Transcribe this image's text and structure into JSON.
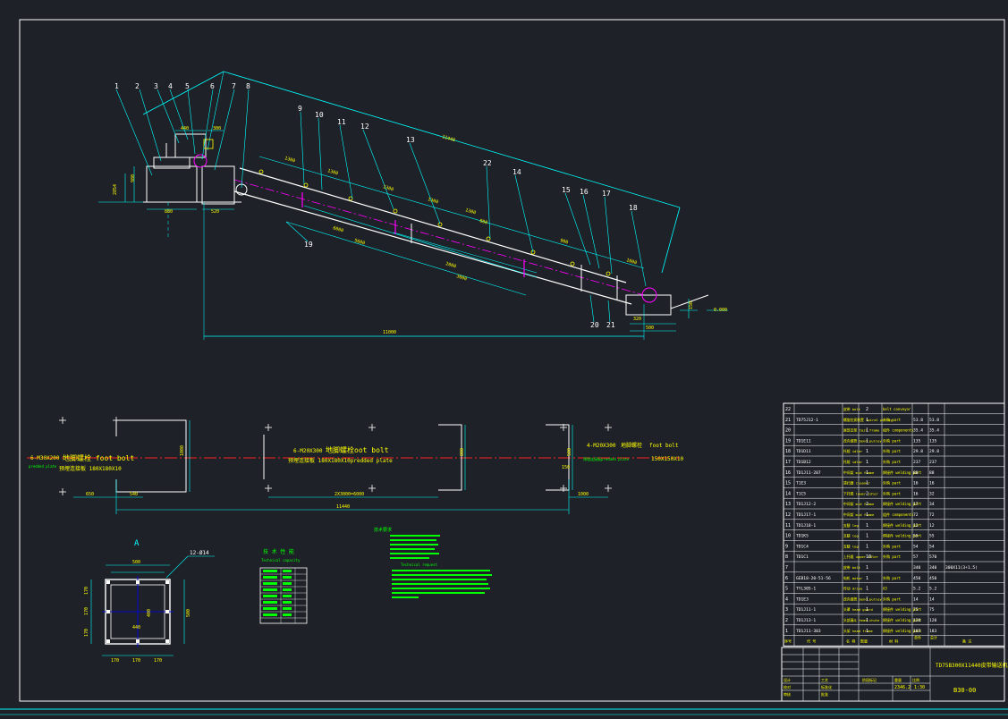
{
  "colors": {
    "background": "#1e2228",
    "line_white": "#ffffff",
    "line_cyan": "#00ffff",
    "line_green": "#00ff00",
    "line_yellow": "#ffff00",
    "line_red": "#ff2020",
    "line_magenta": "#ff00ff"
  },
  "main_view": {
    "part_numbers": [
      "1",
      "2",
      "3",
      "4",
      "5",
      "6",
      "7",
      "8",
      "9",
      "10",
      "11",
      "12",
      "13",
      "22",
      "14",
      "15",
      "16",
      "17",
      "18",
      "19",
      "20",
      "21"
    ],
    "dims": {
      "overall_length": "11000",
      "incline_length": "11440",
      "height_left": "980",
      "elev_left": "2854",
      "elev_right": "0.000",
      "d_440": "440",
      "d_300": "300",
      "d_880": "880",
      "d_520": "520",
      "d_1300a": "1300",
      "d_1300b": "1300",
      "d_1300c": "1300",
      "d_1300d": "1300",
      "d_1300e": "1300",
      "d_900": "900",
      "d_5600": "5600",
      "d_6000": "6000",
      "d_3000": "3000",
      "d_2000": "2000",
      "d_800": "800",
      "d_1000": "1000",
      "d_320": "320",
      "d_500": "500",
      "d_150": "150"
    }
  },
  "foundation_view": {
    "left_bolt": "6-M30X200",
    "left_label": "地脚螺栓 foot bolt",
    "left_plate_en": "predded plate",
    "left_plate_cn": "预埋连接板 180X180X10",
    "mid_bolt": "6-M20X300",
    "mid_label": "地脚螺栓oot bolt",
    "mid_plate": "预埋连接板 180X180X10predded plate",
    "right_bolt": "4-M20X300",
    "right_label": "地脚螺栓",
    "right_label_en": "foot bolt",
    "right_plate_cn": "预埋连接板",
    "right_plate_en": "predded plate",
    "right_plate_size": "150X150X10",
    "d_1000a": "1000",
    "d_650": "650",
    "d_540": "540",
    "d_2x3000": "2X3000=6000",
    "d_11440": "11440",
    "d_800": "800",
    "d_500": "500",
    "d_150": "150",
    "d_1000b": "1000"
  },
  "section_a": {
    "label": "A",
    "bolt_note": "12-Ø14",
    "d_500": "500",
    "d_440": "440",
    "d_400": "400",
    "d_500v": "500",
    "d_170a": "170",
    "d_170b": "170",
    "d_170c": "170",
    "d_170v1": "170",
    "d_170v2": "170",
    "d_170v3": "170"
  },
  "tech_capacity": {
    "title_cn": "技 术 性 能",
    "title_en": "Technical capacity"
  },
  "tech_requirements": {
    "title_cn": "技术要求",
    "title_en": "Technical request"
  },
  "parts_table": {
    "header": {
      "no": "序号",
      "code": "代 号",
      "name": "名 称",
      "qty": "数量",
      "material": "材 料",
      "unit_wt": "单件",
      "total_wt": "总计",
      "note": "备 注"
    },
    "rows": [
      {
        "no": "22",
        "code": "",
        "name": "皮带 belt",
        "qty": "2",
        "material": "belt conveyor",
        "w1": "",
        "w2": "",
        "note": ""
      },
      {
        "no": "21",
        "code": "TD75J12-1",
        "name": "螺旋拉紧装置 spiral pulley",
        "qty": "1",
        "material": "外购 part",
        "w1": "53.8",
        "w2": "53.8",
        "note": ""
      },
      {
        "no": "20",
        "code": "",
        "name": "尾部支架 tail frame",
        "qty": "1",
        "material": "组件 components",
        "w1": "35.4",
        "w2": "35.4",
        "note": ""
      },
      {
        "no": "19",
        "code": "TD1E11",
        "name": "改向滚筒 bend pulley",
        "qty": "1",
        "material": "外购 part",
        "w1": "135",
        "w2": "135",
        "note": ""
      },
      {
        "no": "18",
        "code": "TD1D11",
        "name": "托辊 idler",
        "qty": "1",
        "material": "外购 part",
        "w1": "29.8",
        "w2": "29.8",
        "note": ""
      },
      {
        "no": "17",
        "code": "TD1B12",
        "name": "托辊 idler",
        "qty": "1",
        "material": "外购 part",
        "w1": "237",
        "w2": "237",
        "note": ""
      },
      {
        "no": "16",
        "code": "TD1J11-207",
        "name": "中间架 mid frame",
        "qty": "1",
        "material": "焊接件 welding part",
        "w1": "88",
        "w2": "88",
        "note": ""
      },
      {
        "no": "15",
        "code": "T1E3",
        "name": "清扫器 cleaner",
        "qty": "1",
        "material": "外购 part",
        "w1": "16",
        "w2": "16",
        "note": ""
      },
      {
        "no": "14",
        "code": "T1C5",
        "name": "下托辊 lower idler",
        "qty": "2",
        "material": "外购 part",
        "w1": "16",
        "w2": "32",
        "note": ""
      },
      {
        "no": "13",
        "code": "TD1J12-2",
        "name": "中间架 mid frame",
        "qty": "2",
        "material": "焊接件 welding part",
        "w1": "17",
        "w2": "34",
        "note": ""
      },
      {
        "no": "12",
        "code": "TD1J17-1",
        "name": "中间架 mid frame",
        "qty": "1",
        "material": "组件 components",
        "w1": "72",
        "w2": "72",
        "note": ""
      },
      {
        "no": "11",
        "code": "TD1J18-1",
        "name": "支腿 leg",
        "qty": "1",
        "material": "焊接件 welding part",
        "w1": "12",
        "w2": "12",
        "note": ""
      },
      {
        "no": "10",
        "code": "TD1K5",
        "name": "支腿 leg",
        "qty": "1",
        "material": "焊接件 welding part",
        "w1": "55",
        "w2": "55",
        "note": ""
      },
      {
        "no": "9",
        "code": "TD1C4",
        "name": "支腿 leg",
        "qty": "1",
        "material": "外购 part",
        "w1": "54",
        "w2": "54",
        "note": ""
      },
      {
        "no": "8",
        "code": "TD1C1",
        "name": "上托辊 upper idler",
        "qty": "10",
        "material": "外购 part",
        "w1": "57",
        "w2": "570",
        "note": ""
      },
      {
        "no": "7",
        "code": "",
        "name": "皮带 belt",
        "qty": "1",
        "material": "",
        "w1": "340",
        "w2": "340",
        "note": "300X11(3+1.5)"
      },
      {
        "no": "6",
        "code": "GEB18-20-51-56",
        "name": "电机 motor",
        "qty": "1",
        "material": "外购 part",
        "w1": "450",
        "w2": "450",
        "note": ""
      },
      {
        "no": "5",
        "code": "TYL305-1",
        "name": "传动 drive",
        "qty": "1",
        "material": "A3",
        "w1": "5.2",
        "w2": "5.2",
        "note": ""
      },
      {
        "no": "4",
        "code": "TD1E3",
        "name": "改向滚筒 bend pulley",
        "qty": "1",
        "material": "外购 part",
        "w1": "14",
        "w2": "14",
        "note": ""
      },
      {
        "no": "3",
        "code": "TD1J11-1",
        "name": "头罩 head guard",
        "qty": "1",
        "material": "焊接件 welding part",
        "w1": "75",
        "w2": "75",
        "note": ""
      },
      {
        "no": "2",
        "code": "TD1J13-1",
        "name": "头部漏斗 head chute",
        "qty": "1",
        "material": "焊接件 welding part",
        "w1": "120",
        "w2": "120",
        "note": ""
      },
      {
        "no": "1",
        "code": "TD1J11-303",
        "name": "头架 head frame",
        "qty": "1",
        "material": "焊接件 welding part",
        "w1": "183",
        "w2": "183",
        "note": ""
      }
    ]
  },
  "title_block": {
    "drawing_title": "TD75B300X11440皮带输送机",
    "drawing_no": "B30-00",
    "scale": "1:30",
    "weight": "2346.2",
    "labels": [
      "设计",
      "校对",
      "审核",
      "工艺",
      "标准化",
      "批准",
      "阶段标记",
      "重量",
      "比例"
    ]
  }
}
